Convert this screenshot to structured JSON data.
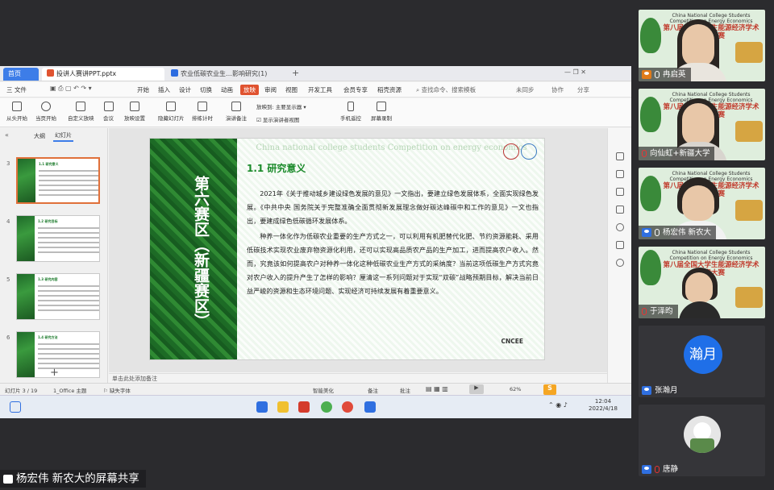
{
  "tabs": {
    "home": "首页",
    "ppt": "投讲人赛讲PPT.pptx",
    "doc": "农业低碳农业生…影响研究(1)"
  },
  "menus": [
    "三 文件",
    "开始",
    "插入",
    "设计",
    "切换",
    "动画",
    "放映",
    "审阅",
    "视图",
    "开发工具",
    "会员专享",
    "稻壳资源"
  ],
  "menu_active_index": 6,
  "menu_right": {
    "search": "查找命令、搜索模板",
    "unsynced": "未同步",
    "collab": "协作",
    "share": "分享"
  },
  "ribbon": [
    "从头开始",
    "当页开始",
    "自定义放映",
    "会议",
    "放映设置",
    "隐藏幻灯片",
    "排练计时",
    "演讲备注",
    "手机遥控",
    "屏幕录制"
  ],
  "ribbon_options": {
    "display_label": "放映到:",
    "display_value": "主要显示器",
    "checkbox_label": "显示演讲者视图"
  },
  "pane_tabs": {
    "outline": "大纲",
    "slides": "幻灯片"
  },
  "thumbs": [
    {
      "num": "3",
      "title": "1.1 研究意义"
    },
    {
      "num": "4",
      "title": "1.2 研究目标"
    },
    {
      "num": "5",
      "title": "1.3 研究内容"
    },
    {
      "num": "6",
      "title": "1.4 研究方法"
    }
  ],
  "slide": {
    "side_title": "第六赛区（新疆赛区）",
    "watermark": "China national college students Competition on energy economics",
    "title": "1.1  研究意义",
    "para1": "2021年《关于推动城乡建设绿色发展的意见》一文指出，要建立绿色发展体系，全面实现绿色发展。《中共中央 国务院关于完整准确全面贯彻新发展理念做好碳达峰碳中和工作的意见》一文也指出，要建成绿色低碳循环发展体系。",
    "para2": "种养一体化作为低碳农业重要的生产方式之一，可以利用有机肥替代化肥、节约资源能耗、采用低碳技术实现农业废弃物资源化利用，还可以实现高品质农产品的生产加工，进而提高农户收入。然而，究竟该如何提高农户对种养一体化这种低碳农业生产方式的采纳度？当前这项低碳生产方式究竟对农户收入的提升产生了怎样的影响？厘清这一系列问题对于实现“双碳”战略预期目标，解决当前日益严峻的资源和生态环境问题、实现经济可持续发展有着重要意义。",
    "badge": "CNCEE"
  },
  "notes": "单击此处添加备注",
  "status": {
    "slide": "幻灯片 3 / 19",
    "theme": "1_Office 主题",
    "font": "缺失字体",
    "beautify": "智能美化",
    "notes": "备注",
    "comments": "批注",
    "zoom": "62%"
  },
  "clock": {
    "time": "12:04",
    "date": "2022/4/18"
  },
  "participants": [
    {
      "name": "冉启英",
      "muted": false,
      "host": true
    },
    {
      "name": "向仙虹+新疆大学"
    },
    {
      "name": "杨宏伟 新农大"
    },
    {
      "name": "于泽昀"
    },
    {
      "name": "张瀚月",
      "avatar_text": "瀚月"
    },
    {
      "name": "唐静"
    }
  ],
  "cam_bg": {
    "en": "China National College Students Competition on Energy Economics",
    "cn": "第八届全国大学生能源经济学术创意大赛"
  },
  "share_label": "杨宏伟  新农大的屏幕共享",
  "colors": {
    "accent": "#e05330",
    "wps_blue": "#3d7de8",
    "slide_green": "#1a8a2a"
  }
}
